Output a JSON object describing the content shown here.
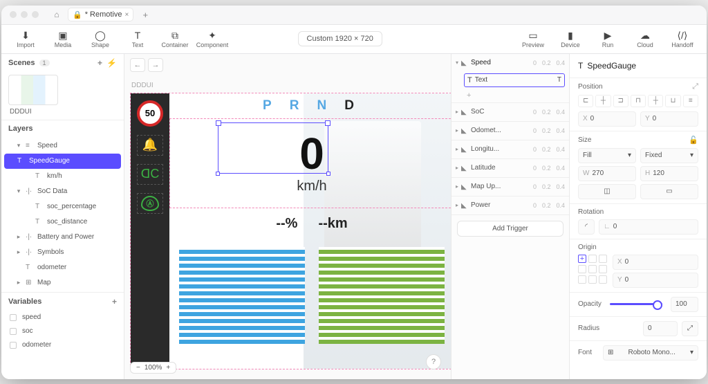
{
  "titlebar": {
    "tab_title": "* Remotive"
  },
  "toolbar": {
    "items": [
      "Import",
      "Media",
      "Shape",
      "Text",
      "Container",
      "Component"
    ],
    "canvas_size": "Custom  1920 × 720",
    "right": [
      "Preview",
      "Device",
      "Run",
      "Cloud",
      "Handoff"
    ]
  },
  "scenes": {
    "label": "Scenes",
    "count": "1",
    "active": "DDDUI"
  },
  "layers": {
    "label": "Layers",
    "tree": [
      {
        "d": "▾",
        "i": "≡",
        "t": "Speed",
        "ind": 1
      },
      {
        "d": "",
        "i": "T",
        "t": "SpeedGauge",
        "ind": 2,
        "sel": true
      },
      {
        "d": "",
        "i": "T",
        "t": "km/h",
        "ind": 2
      },
      {
        "d": "▾",
        "i": "·|·",
        "t": "SoC Data",
        "ind": 1
      },
      {
        "d": "",
        "i": "T",
        "t": "soc_percentage",
        "ind": 2
      },
      {
        "d": "",
        "i": "T",
        "t": "soc_distance",
        "ind": 2
      },
      {
        "d": "▸",
        "i": "·|·",
        "t": "Battery and Power",
        "ind": 1
      },
      {
        "d": "▸",
        "i": "·|·",
        "t": "Symbols",
        "ind": 1
      },
      {
        "d": "",
        "i": "T",
        "t": "odometer",
        "ind": 1
      },
      {
        "d": "▸",
        "i": "⊞",
        "t": "Map",
        "ind": 1
      }
    ]
  },
  "variables": {
    "label": "Variables",
    "items": [
      "speed",
      "soc",
      "odometer"
    ]
  },
  "canvas": {
    "artboard_label": "DDDUI",
    "speed_limit": "50",
    "prnd": [
      "P",
      "R",
      "N",
      "D"
    ],
    "speed_value": "0",
    "speed_unit": "km/h",
    "soc_pct": "--%",
    "soc_dist": "--km",
    "zoom": "100%"
  },
  "triggers": {
    "groups": [
      {
        "name": "Speed",
        "exp": true,
        "nums": [
          "0",
          "0.2",
          "0.4"
        ],
        "child": "Text"
      },
      {
        "name": "SoC",
        "nums": [
          "0",
          "0.2",
          "0.4"
        ]
      },
      {
        "name": "Odomet...",
        "nums": [
          "0",
          "0.2",
          "0.4"
        ]
      },
      {
        "name": "Longitu...",
        "nums": [
          "0",
          "0.2",
          "0.4"
        ]
      },
      {
        "name": "Latitude",
        "nums": [
          "0",
          "0.2",
          "0.4"
        ]
      },
      {
        "name": "Map Up...",
        "nums": [
          "0",
          "0.2",
          "0.4"
        ]
      },
      {
        "name": "Power",
        "nums": [
          "0",
          "0.2",
          "0.4"
        ]
      }
    ],
    "add": "Add Trigger"
  },
  "inspector": {
    "title": "SpeedGauge",
    "position": {
      "label": "Position",
      "x": "0",
      "y": "0"
    },
    "size": {
      "label": "Size",
      "mode_w": "Fill",
      "mode_h": "Fixed",
      "w": "270",
      "h": "120"
    },
    "rotation": {
      "label": "Rotation",
      "value": "0"
    },
    "origin": {
      "label": "Origin",
      "x": "0",
      "y": "0"
    },
    "opacity": {
      "label": "Opacity",
      "value": "100"
    },
    "radius": {
      "label": "Radius",
      "value": "0"
    },
    "font": {
      "label": "Font",
      "value": "Roboto Mono..."
    }
  }
}
